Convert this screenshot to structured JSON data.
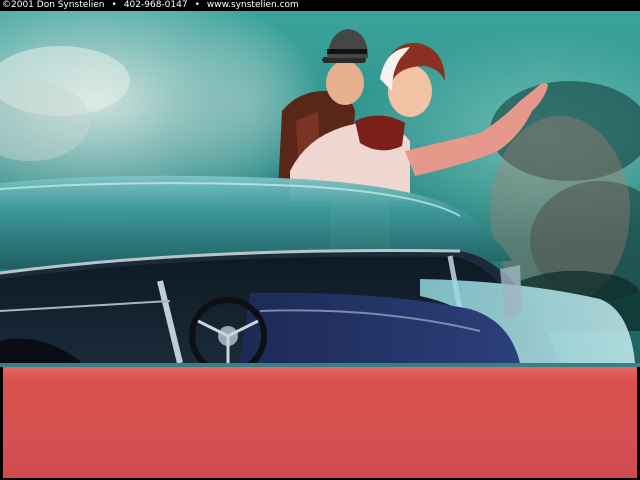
{
  "header": {
    "copyright": "©2001 Don Synstelien",
    "bullet1": "•",
    "phone": "402-968-0147",
    "bullet2": "•",
    "website": "www.synstelien.com"
  },
  "colors": {
    "sky_teal": "#2f8f8a",
    "car_teal": "#3b8a8c",
    "band_red": "#d55151",
    "background": "#000000"
  }
}
